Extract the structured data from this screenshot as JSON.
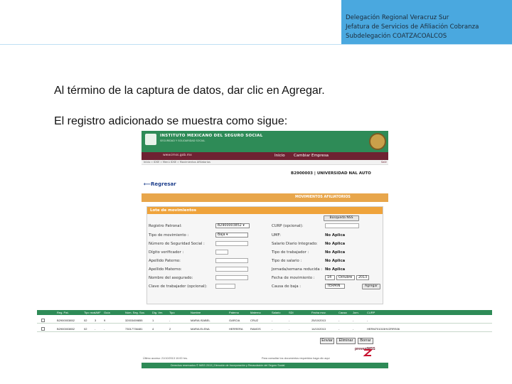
{
  "slide": {
    "header_lines": [
      "Delegación Regional Veracruz Sur",
      "Jefatura de Servicios de Afiliación Cobranza",
      "Subdelegación COATZACOALCOS"
    ],
    "line1": "Al término de la captura de datos, dar clic en Agregar.",
    "line2": "El registro adicionado se muestra como sigue:",
    "accent": "#4aa8df"
  },
  "app": {
    "institution": "INSTITUTO MEXICANO DEL SEGURO SOCIAL",
    "institution_sub": "SEGURIDAD Y SOLIDARIDAD SOCIAL",
    "url": "www.imss.gob.mx",
    "nav_inicio": "Inicio",
    "nav_cambio": "Cambiar Empresa",
    "breadcrumb": "Inicio » IDSE » Menú IDSE » Movimientos Afiliatorios",
    "salir": "Salir",
    "registro": "B2900003 | UNIVERSIDAD NAL AUTO",
    "regresar": "Regresar",
    "movimientos_title": "MOVIMIENTOS AFILIATORIOS",
    "form_title": "Lote de movimientos",
    "labels": {
      "registro_patronal": "Registro Patronal:",
      "tipo_movimiento": "Tipo de movimiento :",
      "nss": "Número de Seguridad Social :",
      "digito": "Dígito verificador :",
      "ap_paterno": "Apellido Paterno:",
      "ap_materno": "Apellido Materno:",
      "nombre": "Nombre del asegurado:",
      "guia": "Clave de trabajador (opcional):",
      "curp": "CURP (opcional):",
      "umf": "UMF:",
      "salario": "Salario Diario Integrado:",
      "tipo_trabajador": "Tipo de trabajador :",
      "tipo_salario": "Tipo de salario :",
      "jornada": "Jornada/semana reducida :",
      "fecha_mov": "Fecha de movimiento :",
      "causa_baja": "Causa de baja :"
    },
    "values": {
      "registro_patronal": "B2900003852",
      "tipo_movimiento": "Baja",
      "no_aplica": "No Aplica",
      "fecha_dia": "14",
      "fecha_mes": "Octubre",
      "fecha_anio": "2013",
      "causa_baja": "TERMIN"
    },
    "buttons": {
      "busqueda": "Búsqueda NSS",
      "agregar": "Agregar",
      "enviar": "Enviar",
      "eliminar": "Eliminar",
      "borrar": "Borrar"
    },
    "grid_headers": [
      "Reg. Pat.",
      "Tipo mov.",
      "UMF",
      "Guía",
      "Núm. Seg. Soc.",
      "Dig. Ver.",
      "Tipo",
      "Nombre",
      "Paterno",
      "Materno",
      "Salario",
      "SDI",
      "Fecha mov.",
      "Causa",
      "Jorn.",
      "CURP"
    ],
    "grid_rows": [
      [
        "B2900003852",
        "02",
        "3",
        "9",
        "32003459855",
        "1",
        "-",
        "MARIA ISABEL",
        "GARCIA",
        "CRUZ",
        "-",
        "-",
        "25/10/2013",
        "-",
        "-",
        "-"
      ],
      [
        "B2900003852",
        "02",
        "-",
        "-",
        "73017736481",
        "4",
        "2",
        "MARIA ELENA",
        "HERRERA",
        "RAMOS",
        "-",
        "-",
        "14/10/2013",
        "-",
        "-",
        "HERM701015HVZRRS06"
      ]
    ],
    "footer_date": "Último acceso: 21/10/2013 10:00 hrs.",
    "footer_help": "Para consultar los documentos requeridos haga clic aquí",
    "footer_copy": "Derechos reservados © IMSS 2013 | Dirección de Incorporación y Recaudación del Seguro Social",
    "imss_mark": "prevenIMSS",
    "colors": {
      "imss_green": "#2e8b57",
      "nav_maroon": "#6e2232",
      "orange": "#efa33b"
    }
  }
}
